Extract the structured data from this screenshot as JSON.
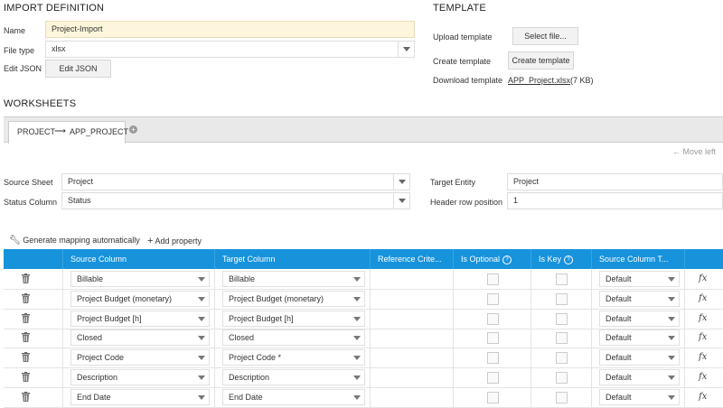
{
  "import_definition": {
    "title": "IMPORT DEFINITION",
    "name_label": "Name",
    "name_value": "Project-Import",
    "filetype_label": "File type",
    "filetype_value": "xlsx",
    "editjson_label": "Edit JSON",
    "editjson_button": "Edit JSON"
  },
  "template": {
    "title": "TEMPLATE",
    "upload_label": "Upload template",
    "upload_button": "Select file...",
    "create_label": "Create template",
    "create_button": "Create template",
    "download_label": "Download template",
    "download_link": "APP_Project.xlsx",
    "download_size": "(7 KB)"
  },
  "worksheets": {
    "title": "WORKSHEETS",
    "tab_source": "PROJECT",
    "tab_target": "APP_PROJECT",
    "add_icon": "plus-circle-icon",
    "move_left": "Move left"
  },
  "sheet_settings": {
    "source_sheet_label": "Source Sheet",
    "source_sheet_value": "Project",
    "status_column_label": "Status Column",
    "status_column_value": "Status",
    "target_entity_label": "Target Entity",
    "target_entity_value": "Project",
    "header_row_label": "Header row position",
    "header_row_value": "1"
  },
  "toolbar": {
    "generate_label": "Generate mapping automatically",
    "add_property_label": "Add property"
  },
  "grid": {
    "columns": [
      "Source Column",
      "Target Column",
      "Reference Crite...",
      "Is Optional",
      "Is Key",
      "Source Column T..."
    ],
    "rows": [
      {
        "source": "Billable",
        "target": "Billable",
        "type": "Default"
      },
      {
        "source": "Project Budget (monetary)",
        "target": "Project Budget (monetary)",
        "type": "Default"
      },
      {
        "source": "Project Budget [h]",
        "target": "Project Budget [h]",
        "type": "Default"
      },
      {
        "source": "Closed",
        "target": "Closed",
        "type": "Default"
      },
      {
        "source": "Project Code",
        "target": "Project Code *",
        "type": "Default"
      },
      {
        "source": "Description",
        "target": "Description",
        "type": "Default"
      },
      {
        "source": "End Date",
        "target": "End Date",
        "type": "Default"
      }
    ],
    "fx_label": "fx"
  },
  "colors": {
    "header_blue": "#1793dc",
    "yellow_field": "#fdf6dc"
  }
}
